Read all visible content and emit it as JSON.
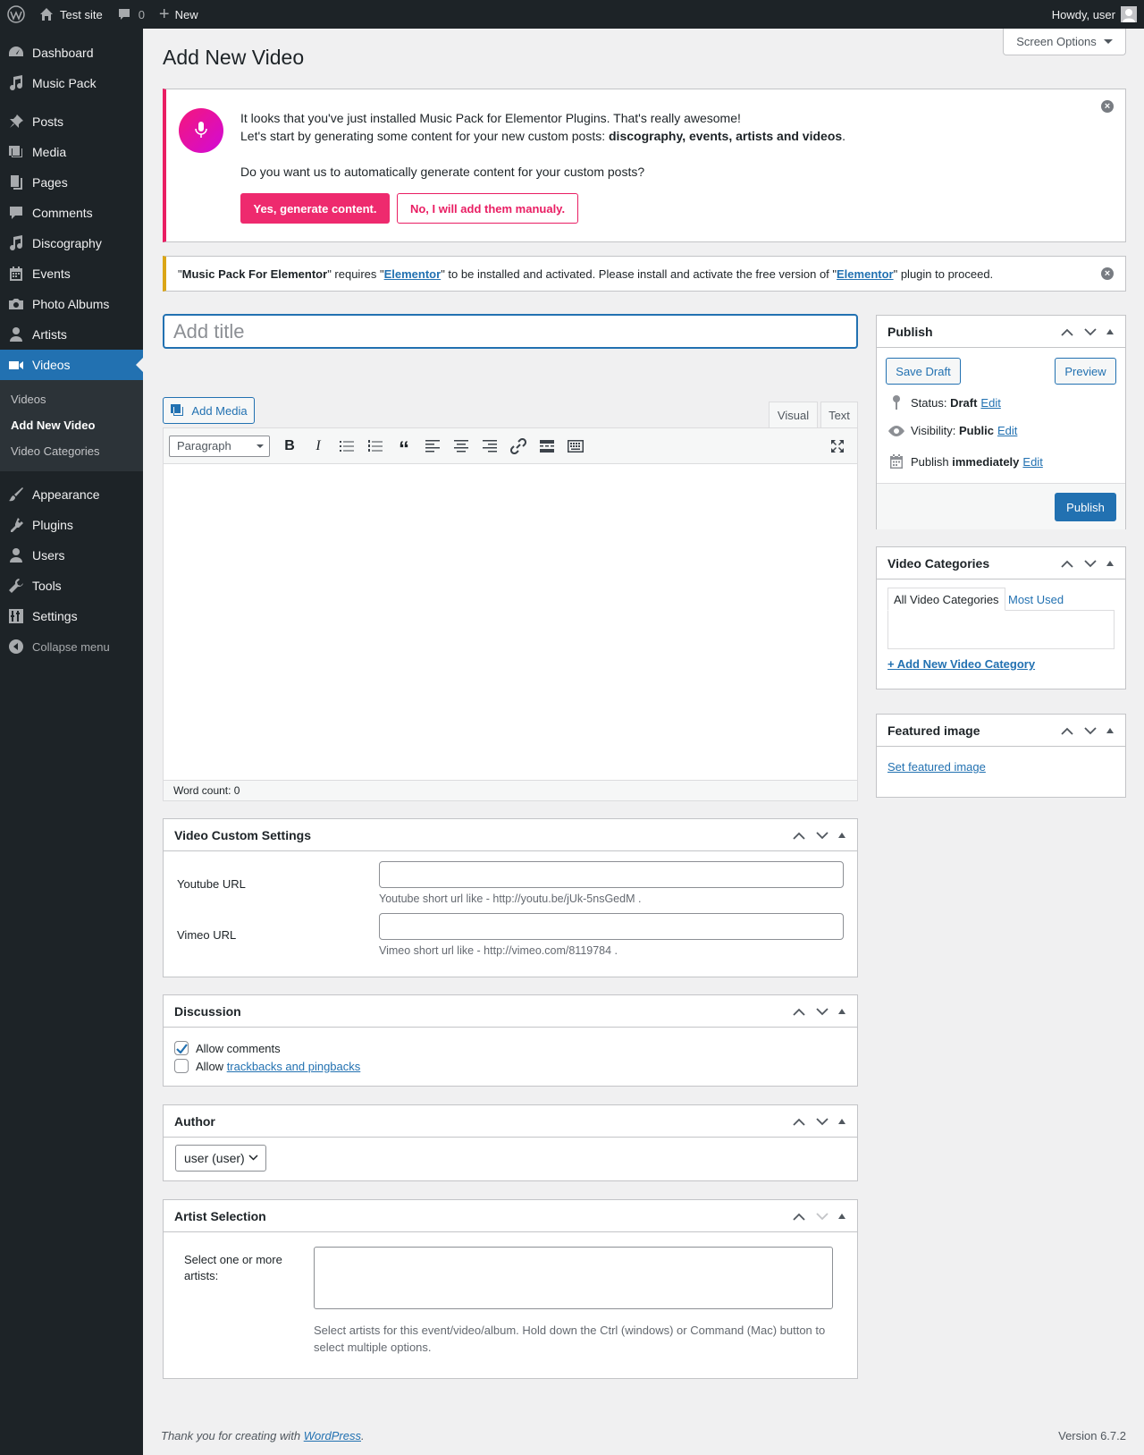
{
  "adminbar": {
    "site_name": "Test site",
    "comments_count": "0",
    "new_label": "New",
    "howdy": "Howdy, user"
  },
  "sidebar": {
    "items": [
      {
        "label": "Dashboard",
        "icon": "dashboard-icon"
      },
      {
        "label": "Music Pack",
        "icon": "music-icon"
      },
      {
        "label": "Posts",
        "icon": "pin-icon"
      },
      {
        "label": "Media",
        "icon": "media-icon"
      },
      {
        "label": "Pages",
        "icon": "pages-icon"
      },
      {
        "label": "Comments",
        "icon": "comments-icon"
      },
      {
        "label": "Discography",
        "icon": "music-icon"
      },
      {
        "label": "Events",
        "icon": "calendar-icon"
      },
      {
        "label": "Photo Albums",
        "icon": "camera-icon"
      },
      {
        "label": "Artists",
        "icon": "user-icon"
      },
      {
        "label": "Videos",
        "icon": "video-icon"
      },
      {
        "label": "Appearance",
        "icon": "brush-icon"
      },
      {
        "label": "Plugins",
        "icon": "plugin-icon"
      },
      {
        "label": "Users",
        "icon": "users-icon"
      },
      {
        "label": "Tools",
        "icon": "wrench-icon"
      },
      {
        "label": "Settings",
        "icon": "settings-icon"
      }
    ],
    "submenu": [
      "Videos",
      "Add New Video",
      "Video Categories"
    ],
    "collapse": "Collapse menu"
  },
  "screen_options": "Screen Options",
  "page_title": "Add New Video",
  "notice_music": {
    "line1": "It looks that you've just installed Music Pack for Elementor Plugins. That's really awesome!",
    "line2_prefix": "Let's start by generating some content for your new custom posts: ",
    "line2_bold": "discography, events, artists and videos",
    "line2_suffix": ".",
    "question": "Do you want us to automatically generate content for your custom posts?",
    "yes_button": "Yes, generate content.",
    "no_button": "No, I will add them manualy.",
    "accent": "#e91e63"
  },
  "notice_elementor": {
    "q1": "\"",
    "plugin": "Music Pack For Elementor",
    "mid1": "\" requires \"",
    "link1": "Elementor",
    "mid2": "\" to be installed and activated. Please install and activate the free version of \"",
    "link2": "Elementor",
    "end": "\" plugin to proceed."
  },
  "title_placeholder": "Add title",
  "editor": {
    "add_media": "Add Media",
    "tab_visual": "Visual",
    "tab_text": "Text",
    "format": "Paragraph",
    "word_count": "Word count: 0"
  },
  "video_settings": {
    "title": "Video Custom Settings",
    "youtube_label": "Youtube URL",
    "youtube_help": "Youtube short url like - http://youtu.be/jUk-5nsGedM .",
    "vimeo_label": "Vimeo URL",
    "vimeo_help": "Vimeo short url like - http://vimeo.com/8119784 ."
  },
  "discussion": {
    "title": "Discussion",
    "allow_comments": "Allow comments",
    "allow_prefix": "Allow ",
    "trackbacks_link": "trackbacks and pingbacks",
    "allow_comments_checked": true,
    "trackbacks_checked": false
  },
  "author": {
    "title": "Author",
    "selected": "user (user)"
  },
  "artist_selection": {
    "title": "Artist Selection",
    "label": "Select one or more artists:",
    "help": "Select artists for this event/video/album. Hold down the Ctrl (windows) or Command (Mac) button to select multiple options."
  },
  "publish": {
    "title": "Publish",
    "save_draft": "Save Draft",
    "preview": "Preview",
    "status_label": "Status: ",
    "status_value": "Draft",
    "visibility_label": "Visibility: ",
    "visibility_value": "Public",
    "publish_label": "Publish ",
    "publish_value": "immediately",
    "edit": "Edit",
    "publish_button": "Publish"
  },
  "video_categories": {
    "title": "Video Categories",
    "tab_all": "All Video Categories",
    "tab_most": "Most Used",
    "add_new": "+ Add New Video Category"
  },
  "featured_image": {
    "title": "Featured image",
    "set_link": "Set featured image"
  },
  "footer": {
    "thanks_prefix": "Thank you for creating with ",
    "wp_link": "WordPress",
    "thanks_suffix": ".",
    "version": "Version 6.7.2"
  }
}
